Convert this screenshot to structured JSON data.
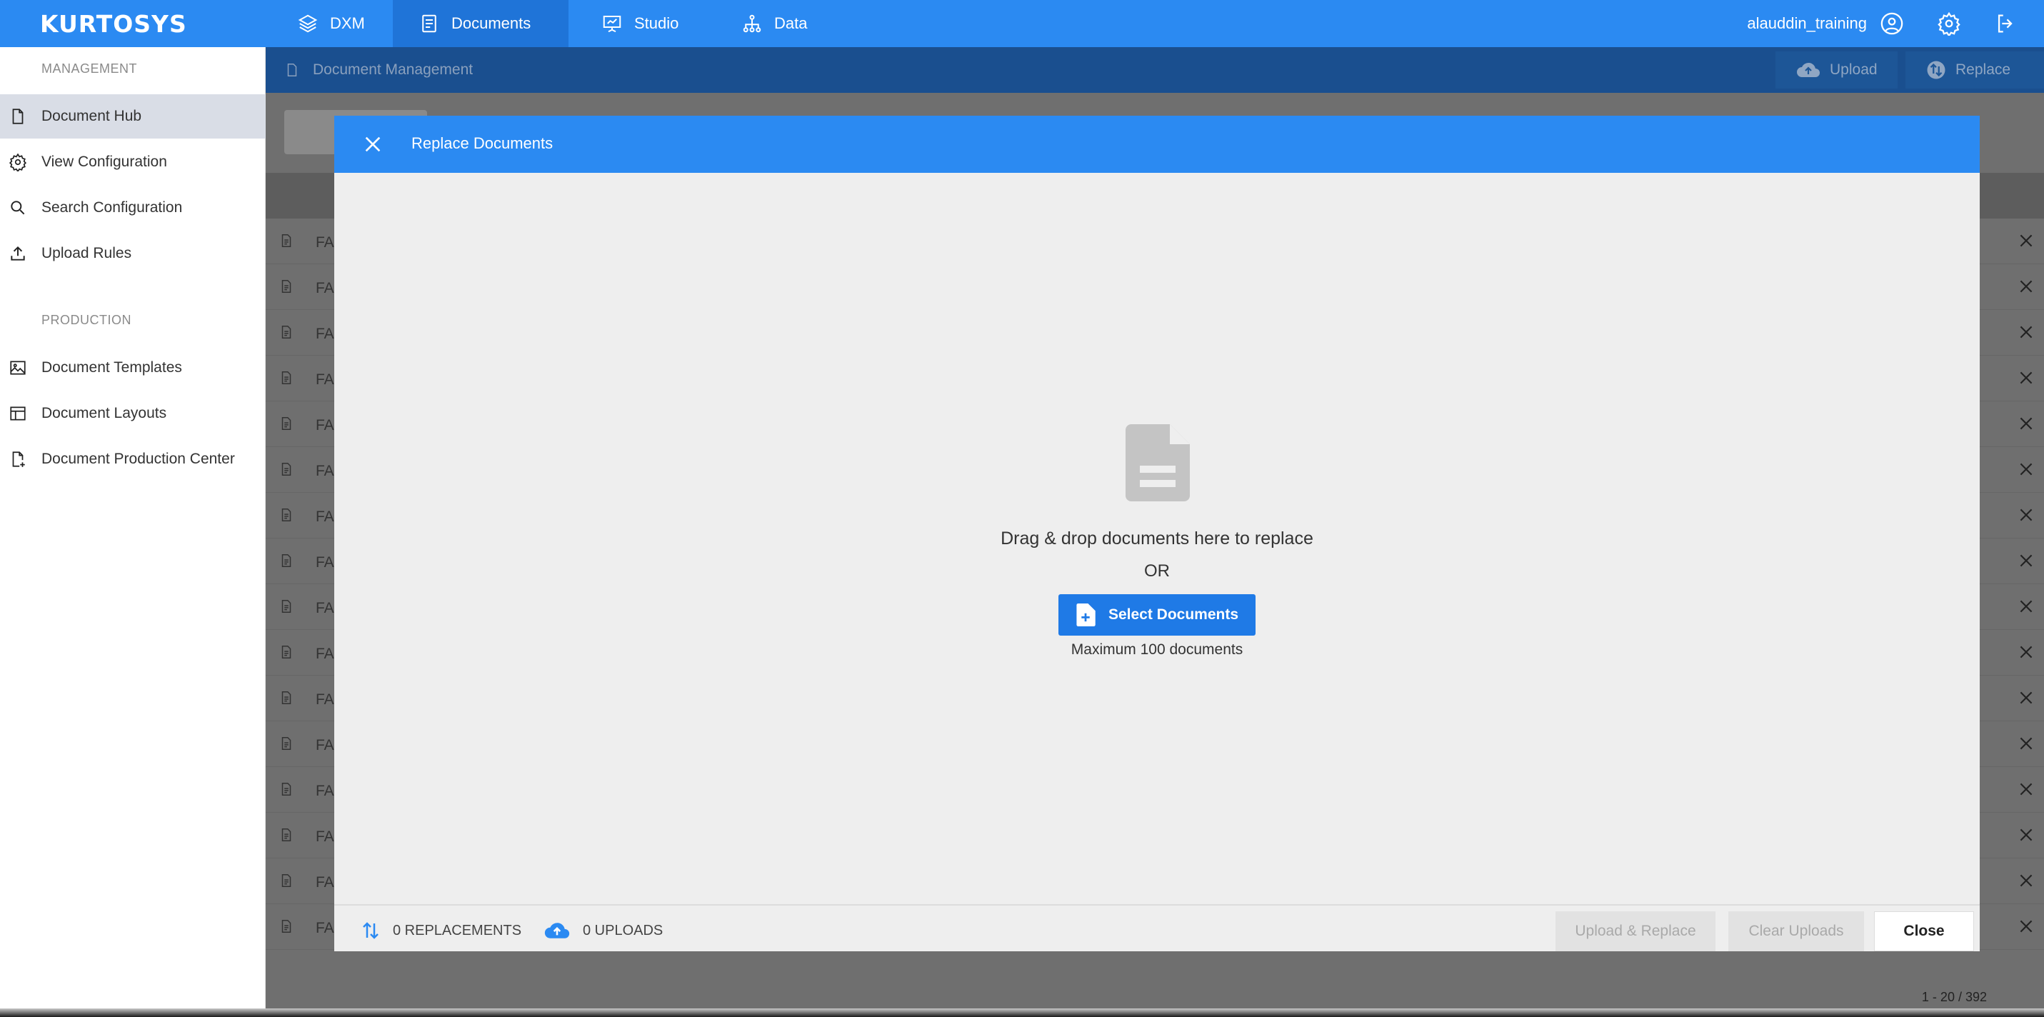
{
  "brand": {
    "logo_text": "KURTOSYS",
    "primary_color": "#2b8af2"
  },
  "topnav": {
    "tabs": [
      {
        "label": "DXM",
        "icon": "layers-icon"
      },
      {
        "label": "Documents",
        "icon": "document-icon",
        "active": true
      },
      {
        "label": "Studio",
        "icon": "presentation-icon"
      },
      {
        "label": "Data",
        "icon": "hierarchy-icon"
      }
    ],
    "username": "alauddin_training"
  },
  "sidebar": {
    "management_title": "MANAGEMENT",
    "management_items": [
      {
        "label": "Document Hub",
        "icon": "file-icon",
        "active": true
      },
      {
        "label": "View Configuration",
        "icon": "gear-icon"
      },
      {
        "label": "Search Configuration",
        "icon": "search-icon"
      },
      {
        "label": "Upload Rules",
        "icon": "upload-icon"
      }
    ],
    "production_title": "PRODUCTION",
    "production_items": [
      {
        "label": "Document Templates",
        "icon": "image-icon"
      },
      {
        "label": "Document Layouts",
        "icon": "layout-icon"
      },
      {
        "label": "Document Production Center",
        "icon": "file-plus-icon"
      }
    ]
  },
  "subheader": {
    "title": "Document Management",
    "upload_label": "Upload",
    "replace_label": "Replace"
  },
  "table": {
    "row_prefix": "FA",
    "pager": "1 - 20 / 392"
  },
  "modal": {
    "title": "Replace Documents",
    "drop_text": "Drag & drop documents here to replace",
    "or_text": "OR",
    "select_label": "Select Documents",
    "max_text": "Maximum 100 documents",
    "replacements": "0 REPLACEMENTS",
    "uploads": "0 UPLOADS",
    "upload_replace_label": "Upload & Replace",
    "clear_label": "Clear Uploads",
    "close_label": "Close"
  }
}
